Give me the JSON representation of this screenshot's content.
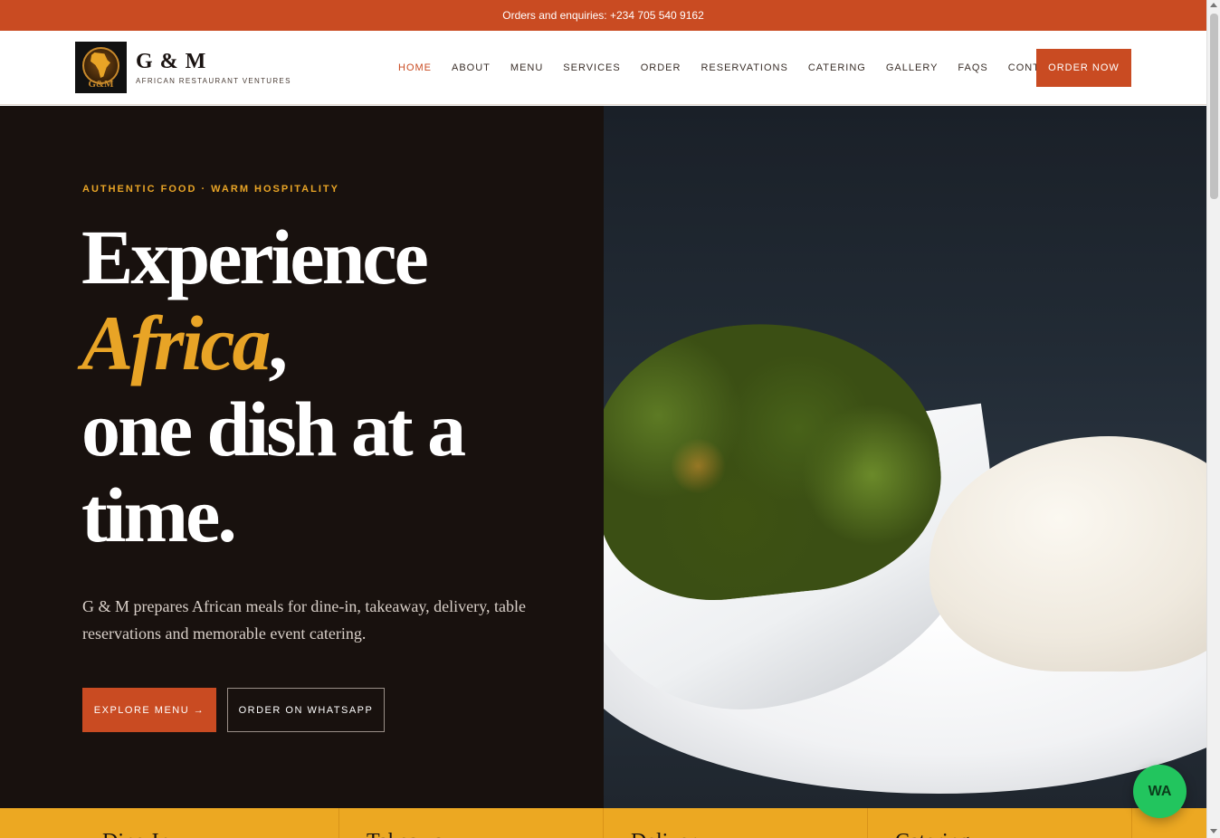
{
  "topbar": {
    "text": "Orders and enquiries: +234 705 540 9162"
  },
  "brand": {
    "monogram": "G&M",
    "name": "G & M",
    "tagline": "AFRICAN RESTAURANT VENTURES"
  },
  "nav": {
    "items": [
      "HOME",
      "ABOUT",
      "MENU",
      "SERVICES",
      "ORDER",
      "RESERVATIONS",
      "CATERING",
      "GALLERY",
      "FAQS",
      "CONTACT"
    ],
    "active": "HOME",
    "cta": "ORDER NOW"
  },
  "hero": {
    "eyebrow": "AUTHENTIC FOOD · WARM HOSPITALITY",
    "headline_line1": "Experience",
    "headline_accent": "Africa",
    "headline_comma": ",",
    "headline_line3": "one dish at a",
    "headline_line4": "time.",
    "lede": "G & M prepares African meals for dine-in, takeaway, delivery, table reservations and memorable event catering.",
    "primary_button": "EXPLORE MENU →",
    "secondary_button": "ORDER ON WHATSAPP"
  },
  "services_strip": {
    "items": [
      "Dine-In",
      "Takeaway",
      "Delivery",
      "Catering"
    ]
  },
  "whatsapp_fab": {
    "label": "WA"
  },
  "colors": {
    "brand": "#c94b22",
    "accent": "#e8a426",
    "dark": "#18110e",
    "whatsapp": "#22c55e"
  }
}
